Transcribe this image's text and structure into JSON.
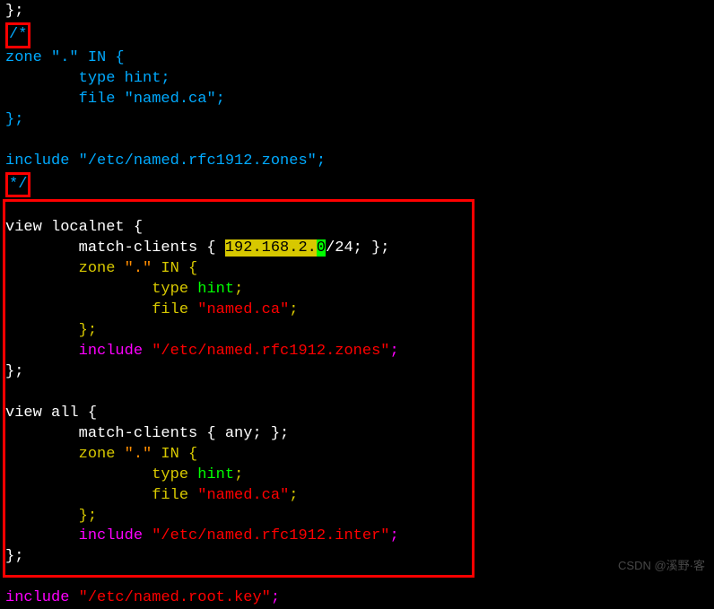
{
  "header": {
    "close": "};",
    "open_comment": "/*",
    "zone_line": "zone \".\" IN {",
    "type_line": "        type hint;",
    "file_kw": "        file ",
    "file_val": "\"named.ca\"",
    "semi": ";",
    "close_brace": "};",
    "include_kw": "include ",
    "include_val": "\"/etc/named.rfc1912.zones\"",
    "close_comment": "*/"
  },
  "view1": {
    "title": "view localnet {",
    "match_pre": "        match-clients { ",
    "ip_hl": "192.168.2.",
    "ip_zero": "0",
    "ip_post": "/24; };",
    "zone_kw": "        zone ",
    "zone_val": "\".\"",
    "zone_post": " IN {",
    "type_kw": "                type ",
    "type_val": "hint",
    "file_kw": "                file ",
    "file_val": "\"named.ca\"",
    "close_inner": "        };",
    "include_kw": "        include ",
    "include_val": "\"/etc/named.rfc1912.zones\"",
    "close": "};"
  },
  "view2": {
    "title": "view all {",
    "match": "        match-clients { any; };",
    "zone_kw": "        zone ",
    "zone_val": "\".\"",
    "zone_post": " IN {",
    "type_kw": "                type ",
    "type_val": "hint",
    "file_kw": "                file ",
    "file_val": "\"named.ca\"",
    "close_inner": "        };",
    "include_kw": "        include ",
    "include_val": "\"/etc/named.rfc1912.inter\"",
    "close": "};"
  },
  "footer": {
    "include_kw": "include ",
    "include_val": "\"/etc/named.root.key\"",
    "semi": ";"
  },
  "watermark": "CSDN @溪野·客"
}
